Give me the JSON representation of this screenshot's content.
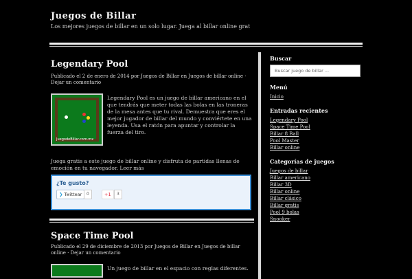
{
  "site": {
    "title": "Juegos de Billar",
    "description": "Los mejores juegos de billar en un solo lugar. Juega al billar online gratis."
  },
  "post1": {
    "title": "Legendary Pool",
    "meta": "Publicado el 2 de enero de 2014 por Juegos de Billar en Juegos de billar online · Dejar un comentario",
    "excerpt": "Legendary Pool es un juego de billar americano en el que tendrás que meter todas las bolas en las troneras de la mesa antes que tu rival. Demuestra que eres el mejor jugador de billar del mundo y conviértete en una leyenda. Usa el ratón para apuntar y controlar la fuerza del tiro.",
    "excerpt_more": "Juega gratis a este juego de billar online y disfruta de partidas llenas de emoción en tu navegador. Leer más"
  },
  "share": {
    "title": "¿Te gusto?",
    "tweet_label": "Twittear",
    "tweet_count": "0",
    "gplus_label": "+1",
    "gplus_count": "3"
  },
  "post2": {
    "title": "Space Time Pool",
    "meta": "Publicado el 29 de diciembre de 2013 por Juegos de Billar en Juegos de billar online · Dejar un comentario",
    "excerpt": "Un juego de billar en el espacio con reglas diferentes."
  },
  "thumb_caption": "JuegodeBillar.com.mx",
  "sidebar": {
    "search_title": "Buscar",
    "search_placeholder": "Buscar juego de billar ...",
    "section1_title": "Menú",
    "section1_link": "Inicio",
    "section2_title": "Entradas recientes",
    "recent": [
      "Legendary Pool",
      "Space Time Pool",
      "Billar 8 Ball",
      "Pool Master",
      "Billar online"
    ],
    "section3_title": "Categorías de juegos",
    "categories": [
      "Juegos de billar",
      "Billar americano",
      "Billar 3D",
      "Billar online",
      "Billar clásico",
      "Billar gratis",
      "Pool 9 bolas",
      "Snooker"
    ]
  }
}
